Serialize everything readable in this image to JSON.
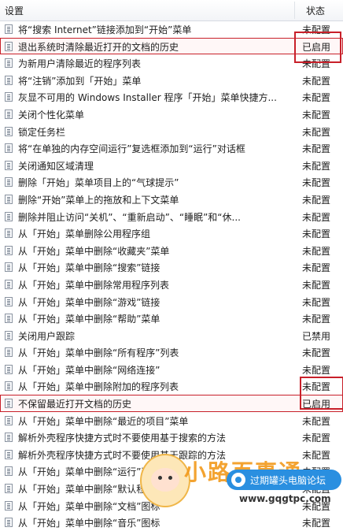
{
  "columns": {
    "setting": "设置",
    "state": "状态"
  },
  "rows": [
    {
      "name": "将“搜索 Internet”链接添加到“开始”菜单",
      "state": "未配置"
    },
    {
      "name": "退出系统时清除最近打开的文档的历史",
      "state": "已启用",
      "highlight": true
    },
    {
      "name": "为新用户清除最近的程序列表",
      "state": "未配置"
    },
    {
      "name": "将“注销”添加到「开始」菜单",
      "state": "未配置"
    },
    {
      "name": "灰显不可用的 Windows Installer 程序「开始」菜单快捷方...",
      "state": "未配置"
    },
    {
      "name": "关闭个性化菜单",
      "state": "未配置"
    },
    {
      "name": "锁定任务栏",
      "state": "未配置"
    },
    {
      "name": "将“在单独的内存空间运行”复选框添加到“运行”对话框",
      "state": "未配置"
    },
    {
      "name": "关闭通知区域清理",
      "state": "未配置"
    },
    {
      "name": "删除「开始」菜单项目上的“气球提示”",
      "state": "未配置"
    },
    {
      "name": "删除“开始”菜单上的拖放和上下文菜单",
      "state": "未配置"
    },
    {
      "name": "删除并阻止访问“关机”、“重新启动”、“睡眠”和“休...",
      "state": "未配置"
    },
    {
      "name": "从「开始」菜单删除公用程序组",
      "state": "未配置"
    },
    {
      "name": "从「开始」菜单中删除“收藏夹”菜单",
      "state": "未配置"
    },
    {
      "name": "从「开始」菜单中删除“搜索”链接",
      "state": "未配置"
    },
    {
      "name": "从「开始」菜单中删除常用程序列表",
      "state": "未配置"
    },
    {
      "name": "从「开始」菜单中删除“游戏”链接",
      "state": "未配置"
    },
    {
      "name": "从「开始」菜单中删除“帮助”菜单",
      "state": "未配置"
    },
    {
      "name": "关闭用户跟踪",
      "state": "已禁用"
    },
    {
      "name": "从「开始」菜单中删除“所有程序”列表",
      "state": "未配置"
    },
    {
      "name": "从「开始」菜单中删除“网络连接”",
      "state": "未配置"
    },
    {
      "name": "从「开始」菜单中删除附加的程序列表",
      "state": "未配置"
    },
    {
      "name": "不保留最近打开文档的历史",
      "state": "已启用",
      "highlight": true
    },
    {
      "name": "从「开始」菜单中删除“最近的项目”菜单",
      "state": "未配置"
    },
    {
      "name": "解析外壳程序快捷方式时不要使用基于搜索的方法",
      "state": "未配置"
    },
    {
      "name": "解析外壳程序快捷方式时不要使用基于跟踪的方法",
      "state": "未配置"
    },
    {
      "name": "从「开始」菜单中删除“运行”菜单",
      "state": "未配置"
    },
    {
      "name": "从「开始」菜单中删除“默认程序”链接",
      "state": "未配置"
    },
    {
      "name": "从「开始」菜单中删除“文档”图标",
      "state": "未配置"
    },
    {
      "name": "从「开始」菜单中删除“音乐”图标",
      "state": "未配置"
    }
  ],
  "watermark": {
    "title": "小路百事通",
    "badge": "过期罐头电脑论坛",
    "url": "www.gqgtpc.com"
  }
}
